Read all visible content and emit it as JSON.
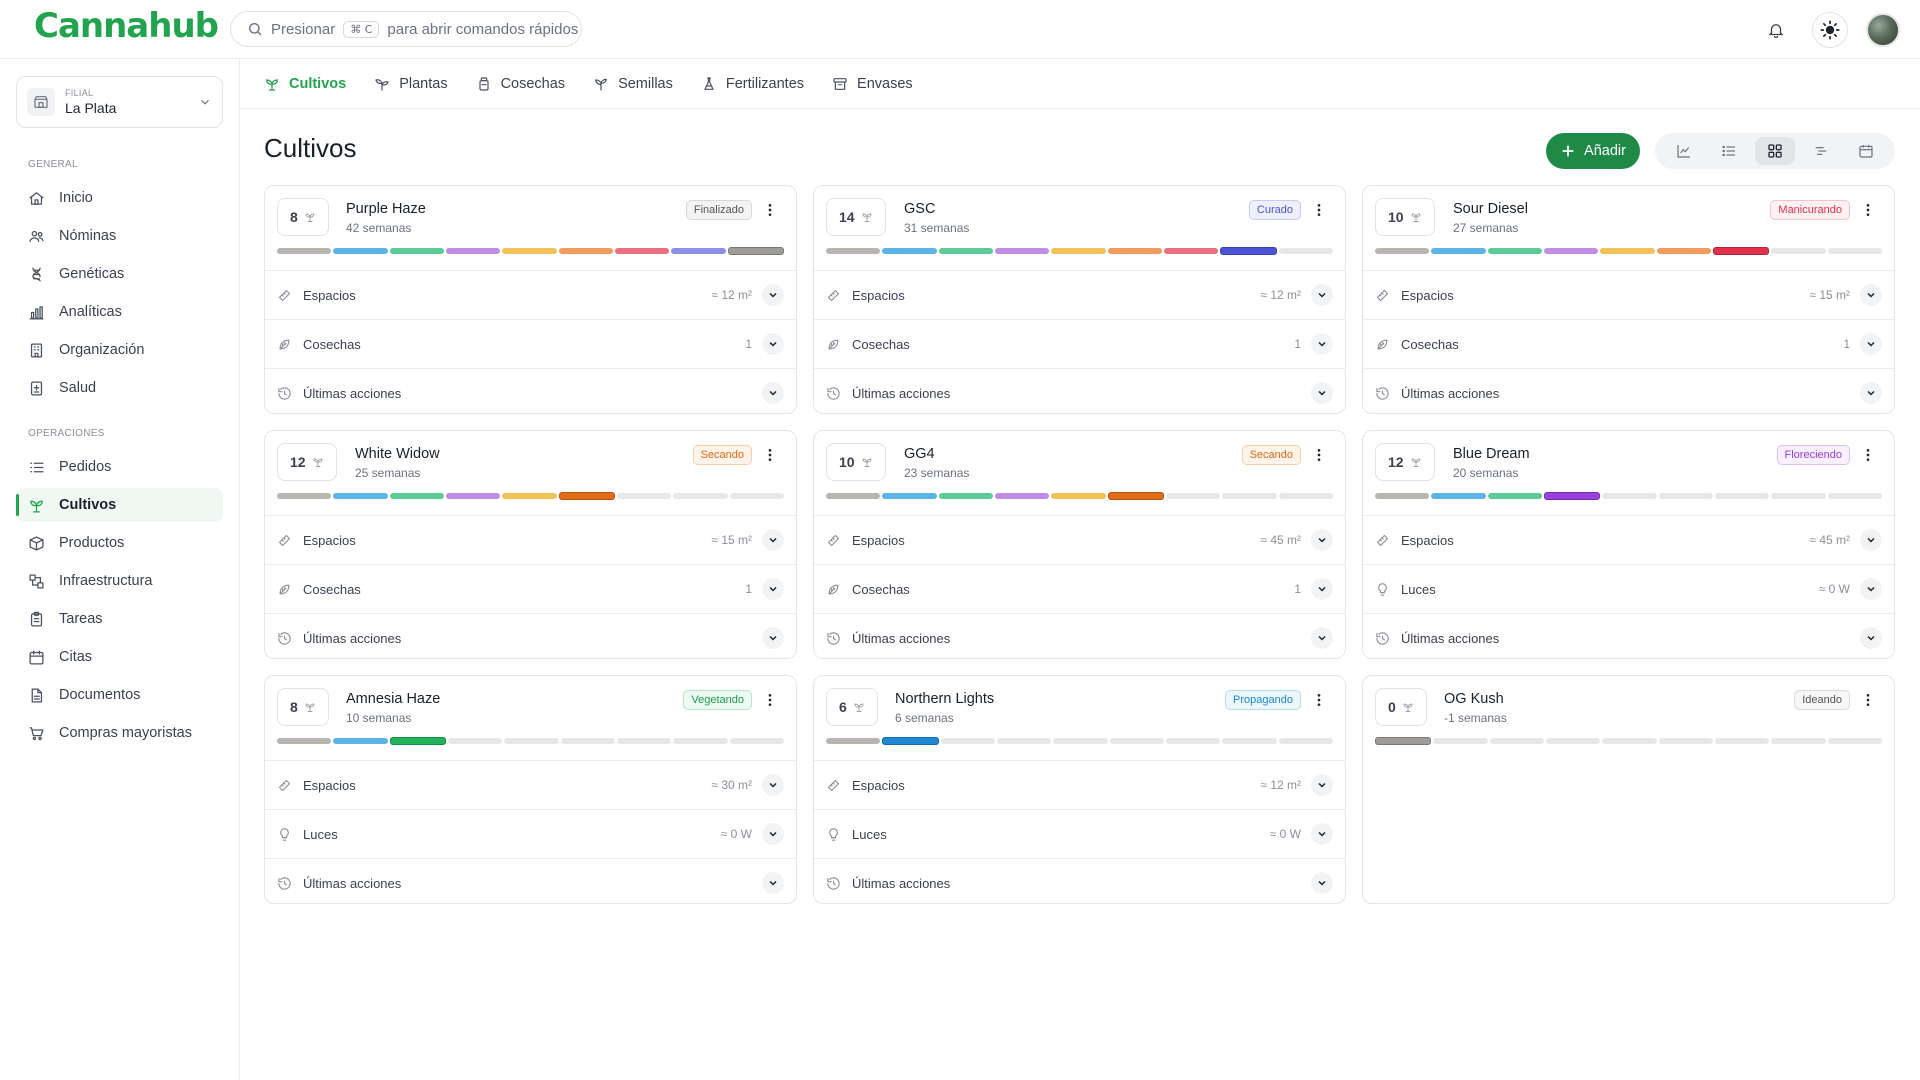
{
  "app": {
    "brand": "Cannahub",
    "search": {
      "prefix": "Presionar",
      "kbd": "⌘ C",
      "suffix": "para abrir comandos rápidos"
    }
  },
  "sidebar": {
    "branch": {
      "caption": "FILIAL",
      "name": "La Plata"
    },
    "sections": [
      {
        "title": "GENERAL",
        "items": [
          {
            "label": "Inicio",
            "icon": "home-icon"
          },
          {
            "label": "Nóminas",
            "icon": "users-icon"
          },
          {
            "label": "Genéticas",
            "icon": "dna-icon"
          },
          {
            "label": "Analíticas",
            "icon": "bar-chart-icon"
          },
          {
            "label": "Organización",
            "icon": "building-icon"
          },
          {
            "label": "Salud",
            "icon": "medical-icon"
          }
        ]
      },
      {
        "title": "OPERACIONES",
        "items": [
          {
            "label": "Pedidos",
            "icon": "list-icon"
          },
          {
            "label": "Cultivos",
            "icon": "sprout-icon",
            "active": true
          },
          {
            "label": "Productos",
            "icon": "box-icon"
          },
          {
            "label": "Infraestructura",
            "icon": "infra-icon"
          },
          {
            "label": "Tareas",
            "icon": "clipboard-icon"
          },
          {
            "label": "Citas",
            "icon": "calendar-icon"
          },
          {
            "label": "Documentos",
            "icon": "document-icon"
          },
          {
            "label": "Compras mayoristas",
            "icon": "cart-icon"
          }
        ]
      }
    ]
  },
  "tabs": [
    {
      "label": "Cultivos",
      "icon": "sprout-icon",
      "active": true
    },
    {
      "label": "Plantas",
      "icon": "plant-icon"
    },
    {
      "label": "Cosechas",
      "icon": "jar-icon"
    },
    {
      "label": "Semillas",
      "icon": "seedling-icon"
    },
    {
      "label": "Fertilizantes",
      "icon": "flask-icon"
    },
    {
      "label": "Envases",
      "icon": "package-icon"
    }
  ],
  "page": {
    "title": "Cultivos",
    "add_label": "Añadir"
  },
  "stage_colors": [
    "#b9b6b1",
    "#5cb3e6",
    "#5ccb98",
    "#c08ce6",
    "#f2c15a",
    "#f29b5e",
    "#ea6f7f",
    "#8d8fe6",
    "#a8a6a2"
  ],
  "empty_color": "#e6e7e9",
  "status_styles": {
    "Finalizado": {
      "color": "#555",
      "bg": "#f3f3f3",
      "border": "#d8d8d8"
    },
    "Curado": {
      "color": "#4b54d8",
      "bg": "#eef0ff",
      "border": "#c6cbfb"
    },
    "Manicurando": {
      "color": "#e0304c",
      "bg": "#fff0f2",
      "border": "#f7c2cb"
    },
    "Secando": {
      "color": "#e56b18",
      "bg": "#fff4ea",
      "border": "#f7cfa8"
    },
    "Floreciendo": {
      "color": "#9b3ee0",
      "bg": "#f8efff",
      "border": "#dfc0f7"
    },
    "Vegetando": {
      "color": "#1f9a50",
      "bg": "#ecfaf1",
      "border": "#b5e7c8"
    },
    "Propagando": {
      "color": "#1e88d4",
      "bg": "#ecf6fe",
      "border": "#b9dcf5"
    },
    "Ideando": {
      "color": "#555",
      "bg": "#f6f6f6",
      "border": "#dadada"
    }
  },
  "current_colors": {
    "Finalizado": "#9e9c98",
    "Curado": "#4b54d8",
    "Manicurando": "#e0304c",
    "Secando": "#e56b18",
    "Floreciendo": "#9b3ee0",
    "Vegetando": "#1fb35a",
    "Propagando": "#1e88d4",
    "Ideando": "#9e9c98"
  },
  "crops": [
    {
      "count": "8",
      "name": "Purple Haze",
      "weeks": "42 semanas",
      "status": "Finalizado",
      "stage": 9,
      "rows": [
        {
          "icon": "ruler-icon",
          "label": "Espacios",
          "value": "≈ 12 m²"
        },
        {
          "icon": "harvest-icon",
          "label": "Cosechas",
          "value": "1"
        },
        {
          "icon": "history-icon",
          "label": "Últimas acciones",
          "value": ""
        }
      ]
    },
    {
      "count": "14",
      "name": "GSC",
      "weeks": "31 semanas",
      "status": "Curado",
      "stage": 8,
      "rows": [
        {
          "icon": "ruler-icon",
          "label": "Espacios",
          "value": "≈ 12 m²"
        },
        {
          "icon": "harvest-icon",
          "label": "Cosechas",
          "value": "1"
        },
        {
          "icon": "history-icon",
          "label": "Últimas acciones",
          "value": ""
        }
      ]
    },
    {
      "count": "10",
      "name": "Sour Diesel",
      "weeks": "27 semanas",
      "status": "Manicurando",
      "stage": 7,
      "rows": [
        {
          "icon": "ruler-icon",
          "label": "Espacios",
          "value": "≈ 15 m²"
        },
        {
          "icon": "harvest-icon",
          "label": "Cosechas",
          "value": "1"
        },
        {
          "icon": "history-icon",
          "label": "Últimas acciones",
          "value": ""
        }
      ]
    },
    {
      "count": "12",
      "name": "White Widow",
      "weeks": "25 semanas",
      "status": "Secando",
      "stage": 6,
      "rows": [
        {
          "icon": "ruler-icon",
          "label": "Espacios",
          "value": "≈ 15 m²"
        },
        {
          "icon": "harvest-icon",
          "label": "Cosechas",
          "value": "1"
        },
        {
          "icon": "history-icon",
          "label": "Últimas acciones",
          "value": ""
        }
      ]
    },
    {
      "count": "10",
      "name": "GG4",
      "weeks": "23 semanas",
      "status": "Secando",
      "stage": 6,
      "rows": [
        {
          "icon": "ruler-icon",
          "label": "Espacios",
          "value": "≈ 45 m²"
        },
        {
          "icon": "harvest-icon",
          "label": "Cosechas",
          "value": "1"
        },
        {
          "icon": "history-icon",
          "label": "Últimas acciones",
          "value": ""
        }
      ]
    },
    {
      "count": "12",
      "name": "Blue Dream",
      "weeks": "20 semanas",
      "status": "Floreciendo",
      "stage": 4,
      "rows": [
        {
          "icon": "ruler-icon",
          "label": "Espacios",
          "value": "≈ 45 m²"
        },
        {
          "icon": "bulb-icon",
          "label": "Luces",
          "value": "≈ 0 W"
        },
        {
          "icon": "history-icon",
          "label": "Últimas acciones",
          "value": ""
        }
      ]
    },
    {
      "count": "8",
      "name": "Amnesia Haze",
      "weeks": "10 semanas",
      "status": "Vegetando",
      "stage": 3,
      "rows": [
        {
          "icon": "ruler-icon",
          "label": "Espacios",
          "value": "≈ 30 m²"
        },
        {
          "icon": "bulb-icon",
          "label": "Luces",
          "value": "≈ 0 W"
        },
        {
          "icon": "history-icon",
          "label": "Últimas acciones",
          "value": ""
        }
      ]
    },
    {
      "count": "6",
      "name": "Northern Lights",
      "weeks": "6 semanas",
      "status": "Propagando",
      "stage": 2,
      "rows": [
        {
          "icon": "ruler-icon",
          "label": "Espacios",
          "value": "≈ 12 m²"
        },
        {
          "icon": "bulb-icon",
          "label": "Luces",
          "value": "≈ 0 W"
        },
        {
          "icon": "history-icon",
          "label": "Últimas acciones",
          "value": ""
        }
      ]
    },
    {
      "count": "0",
      "name": "OG Kush",
      "weeks": "-1 semanas",
      "status": "Ideando",
      "stage": 1,
      "rows": []
    }
  ]
}
